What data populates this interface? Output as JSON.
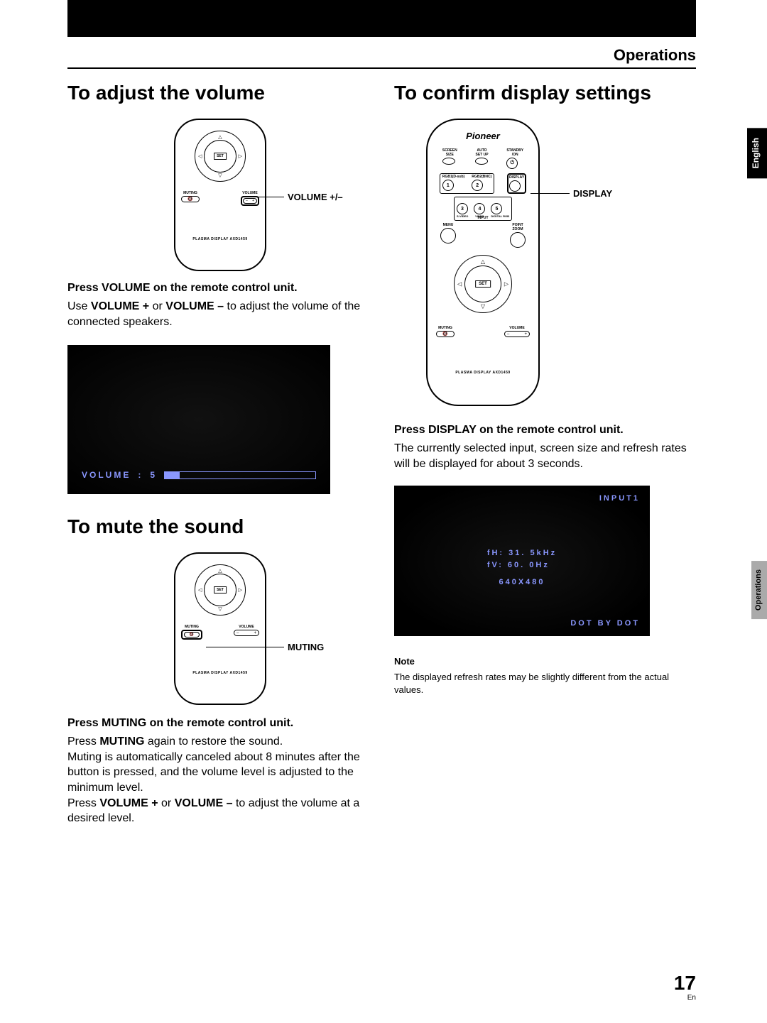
{
  "header": {
    "section": "Operations"
  },
  "sideTabs": {
    "lang": "English",
    "section": "Operations"
  },
  "page": {
    "number": "17",
    "lang": "En"
  },
  "remote": {
    "set": "SET",
    "muting": "MUTING",
    "volume": "VOLUME",
    "model": "PLASMA DISPLAY  AXD1459",
    "brand": "Pioneer",
    "buttons": {
      "screenSize": "SCREEN\nSIZE",
      "autoSetup": "AUTO\nSET UP",
      "standby": "STANDBY\n/ON",
      "rgb1": "RGB1(D-sub)",
      "rgb2": "RGB2(BNC)",
      "display": "DISPLAY",
      "svideo": "S-VIDEO",
      "video": "VIDEO",
      "drgb": "DIGITAL RGB",
      "input": "INPUT",
      "menu": "MENU",
      "pointZoom": "POINT\nZOOM",
      "n1": "1",
      "n2": "2",
      "n3": "3",
      "n4": "4",
      "n5": "5"
    }
  },
  "left": {
    "h1": "To adjust the volume",
    "callout_vol": "VOLUME +/–",
    "sub1": "Press VOLUME on the remote control unit.",
    "p1a": "Use ",
    "p1b": "VOLUME +",
    "p1c": " or ",
    "p1d": "VOLUME –",
    "p1e": " to adjust the volume of the connected speakers.",
    "osd": {
      "label": "VOLUME",
      "sep": ":",
      "val": "5"
    },
    "h2": "To mute the sound",
    "callout_mute": "MUTING",
    "sub2": "Press MUTING on the remote control unit.",
    "p2a": "Press ",
    "p2b": "MUTING",
    "p2c": " again to restore the sound.",
    "p3": "Muting is automatically canceled about 8 minutes after the button is pressed, and the volume level is adjusted to the minimum level.",
    "p4a": "Press ",
    "p4b": "VOLUME +",
    "p4c": " or ",
    "p4d": "VOLUME –",
    "p4e": " to adjust the volume at a desired level."
  },
  "right": {
    "h1": "To confirm display settings",
    "callout_display": "DISPLAY",
    "sub1": "Press DISPLAY on the remote control unit.",
    "p1": "The currently selected input, screen size and refresh rates will be displayed for about 3 seconds.",
    "osd": {
      "input": "INPUT1",
      "fh": "fH: 31. 5kHz",
      "fv": "fV: 60. 0Hz",
      "res": "640X480",
      "dot": "DOT BY DOT"
    },
    "noteH": "Note",
    "note": "The displayed refresh rates may be slightly different from the actual values."
  }
}
